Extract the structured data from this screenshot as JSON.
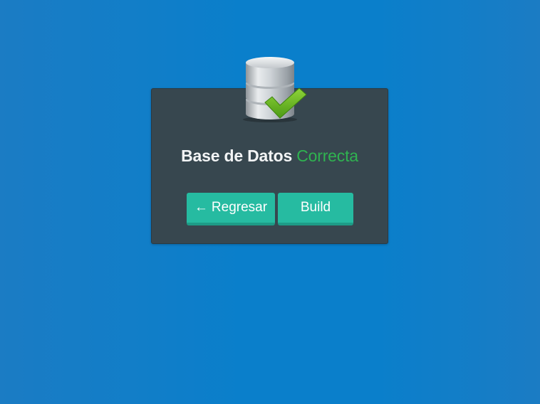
{
  "card": {
    "title_main": "Base de Datos",
    "title_status": "Correcta",
    "icon": "database-check-icon"
  },
  "buttons": {
    "back_arrow": "←",
    "back_label": "Regresar",
    "build_label": "Build"
  },
  "colors": {
    "background": "#0a7fcb",
    "card": "#37474f",
    "status_text": "#2fb350",
    "button": "#26bba1"
  }
}
